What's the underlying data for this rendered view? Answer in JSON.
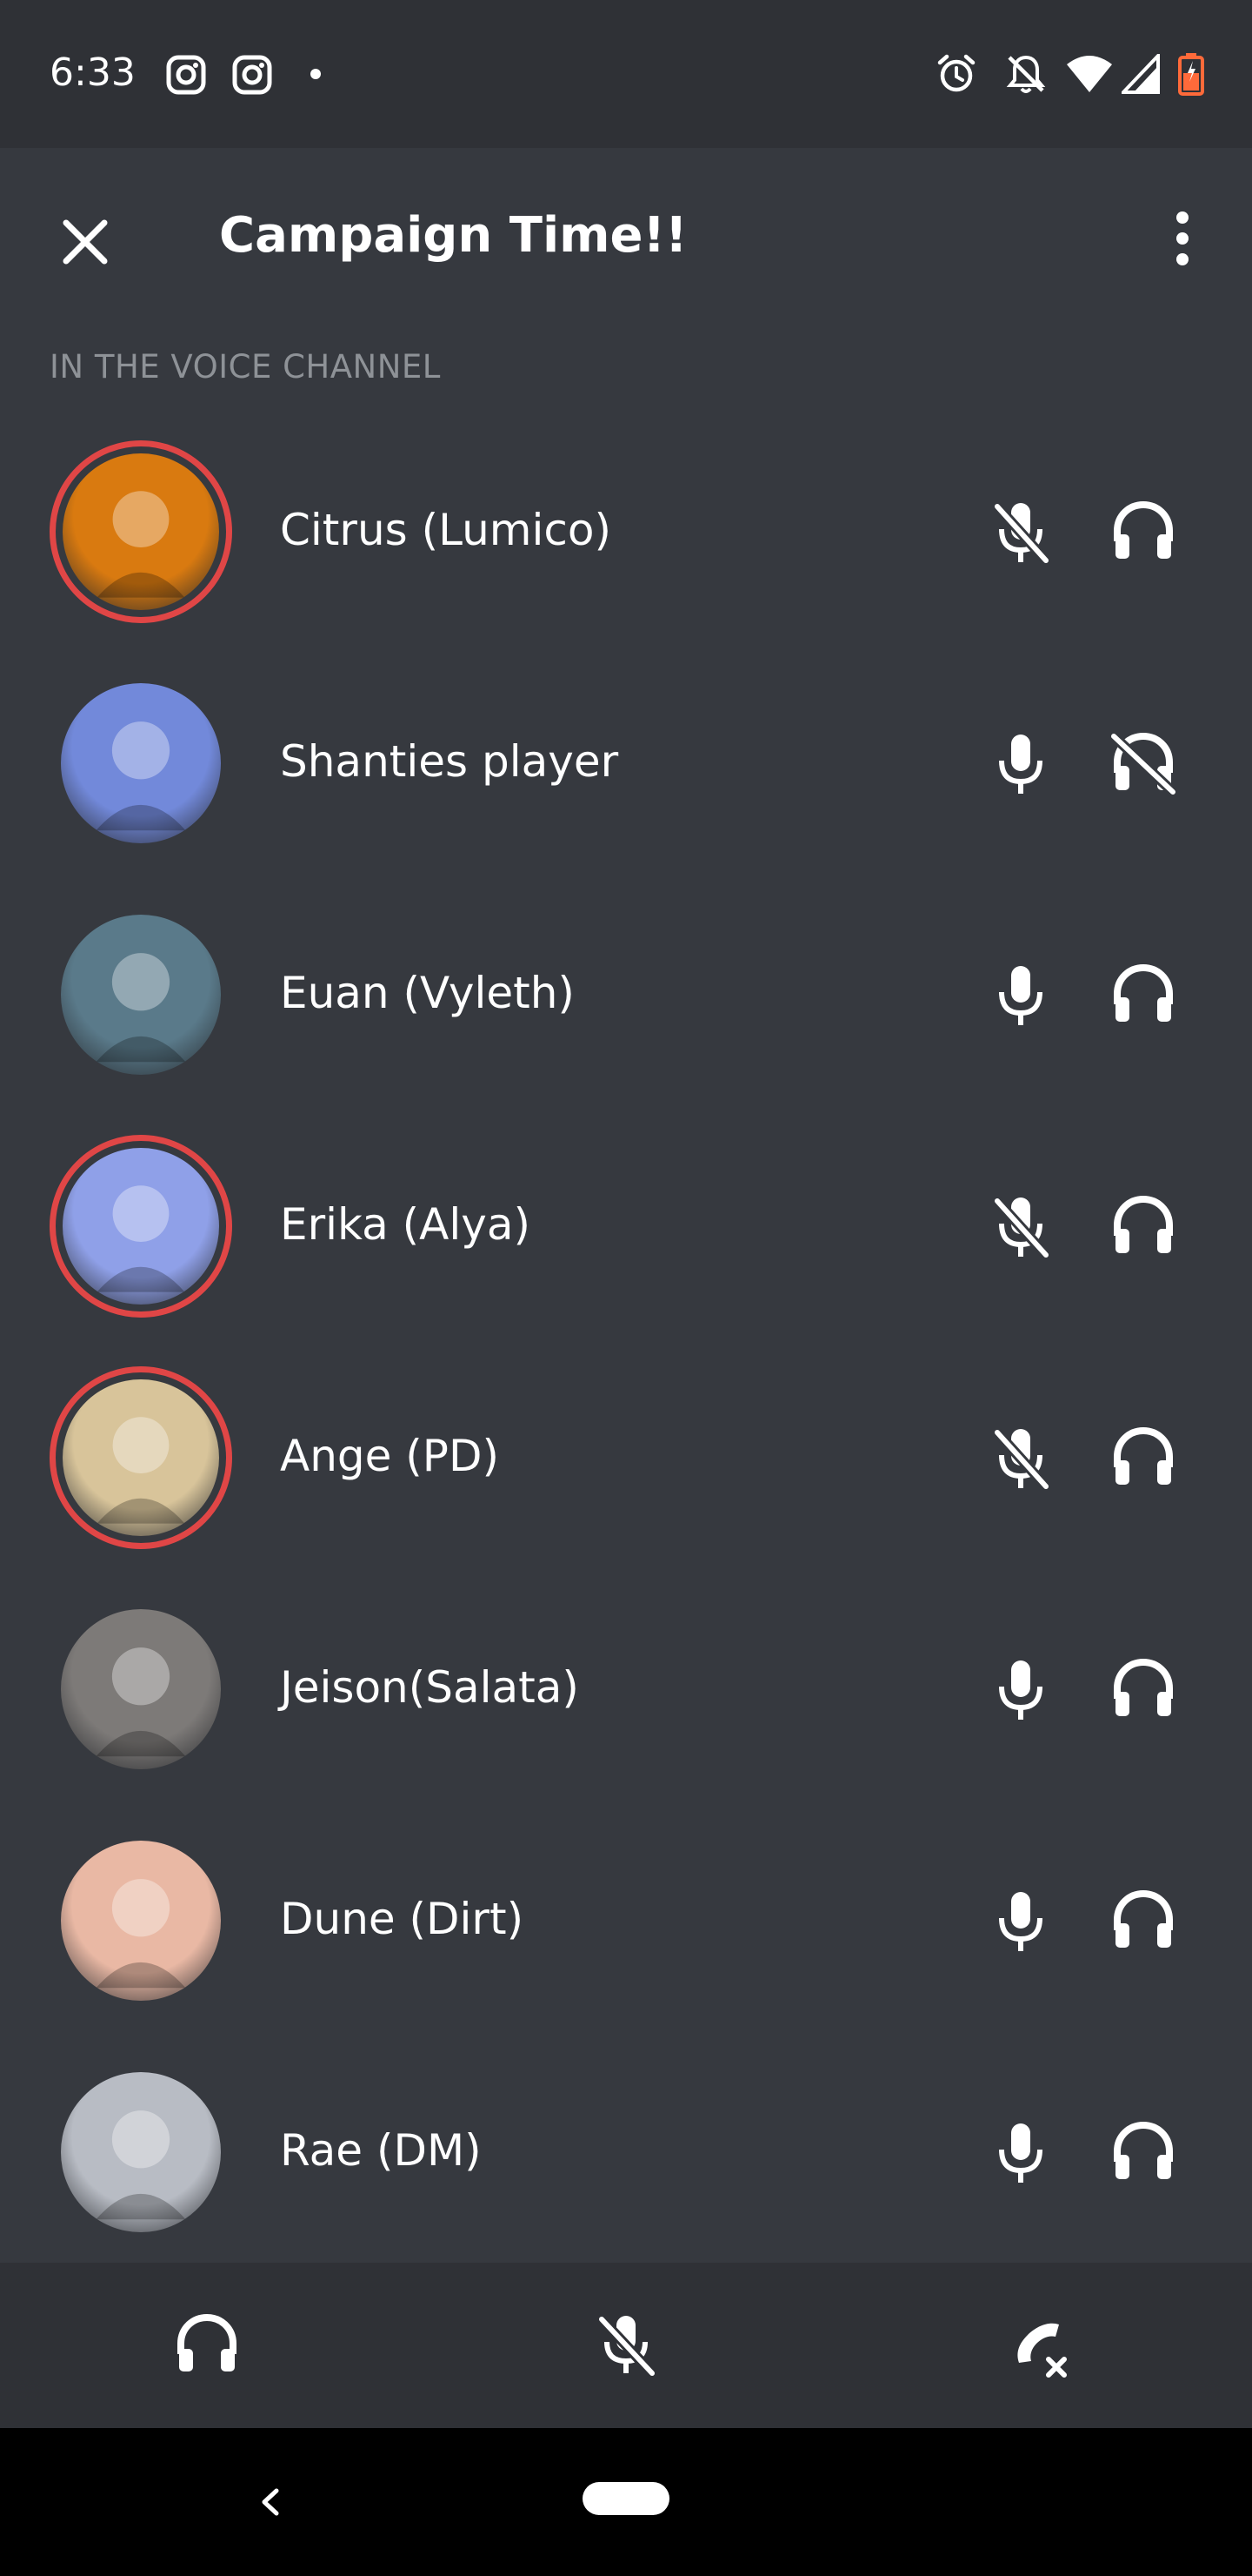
{
  "status_bar": {
    "time": "6:33",
    "left_icons": [
      "instagram-icon",
      "instagram-icon",
      "notification-dot-icon"
    ],
    "right_icons": [
      "alarm-icon",
      "notifications-off-icon",
      "wifi-icon",
      "signal-icon",
      "battery-icon"
    ]
  },
  "header": {
    "title": "Campaign Time!!",
    "close_icon": "close-icon",
    "more_icon": "more-vertical-icon"
  },
  "section_label": "IN THE VOICE CHANNEL",
  "members": [
    {
      "name": "Citrus (Lumico)",
      "speaking": true,
      "mic": "muted",
      "headphones": "on",
      "avatar_color": "#d97a10"
    },
    {
      "name": "Shanties player",
      "speaking": false,
      "mic": "on",
      "headphones": "deafened",
      "avatar_color": "#7289da"
    },
    {
      "name": "Euan (Vyleth)",
      "speaking": false,
      "mic": "on",
      "headphones": "on",
      "avatar_color": "#5a7a8a"
    },
    {
      "name": "Erika (Alya)",
      "speaking": true,
      "mic": "muted",
      "headphones": "on",
      "avatar_color": "#8fa0e8"
    },
    {
      "name": "Ange (PD)",
      "speaking": true,
      "mic": "muted",
      "headphones": "on",
      "avatar_color": "#d8c49a"
    },
    {
      "name": "Jeison(Salata)",
      "speaking": false,
      "mic": "on",
      "headphones": "on",
      "avatar_color": "#7d7a78"
    },
    {
      "name": "Dune (Dirt)",
      "speaking": false,
      "mic": "on",
      "headphones": "on",
      "avatar_color": "#e9b8a4"
    },
    {
      "name": "Rae (DM)",
      "speaking": false,
      "mic": "on",
      "headphones": "on",
      "avatar_color": "#b8bcc4"
    }
  ],
  "bottom_bar": {
    "buttons": [
      "headphones-icon",
      "mic-muted-icon",
      "disconnect-call-icon"
    ]
  },
  "nav_bar": {
    "buttons": [
      "back-icon",
      "home-pill"
    ]
  },
  "colors": {
    "background": "#36393f",
    "bars": "#2f3136",
    "speaking_ring": "#e04646",
    "muted_text": "#8e9297"
  }
}
